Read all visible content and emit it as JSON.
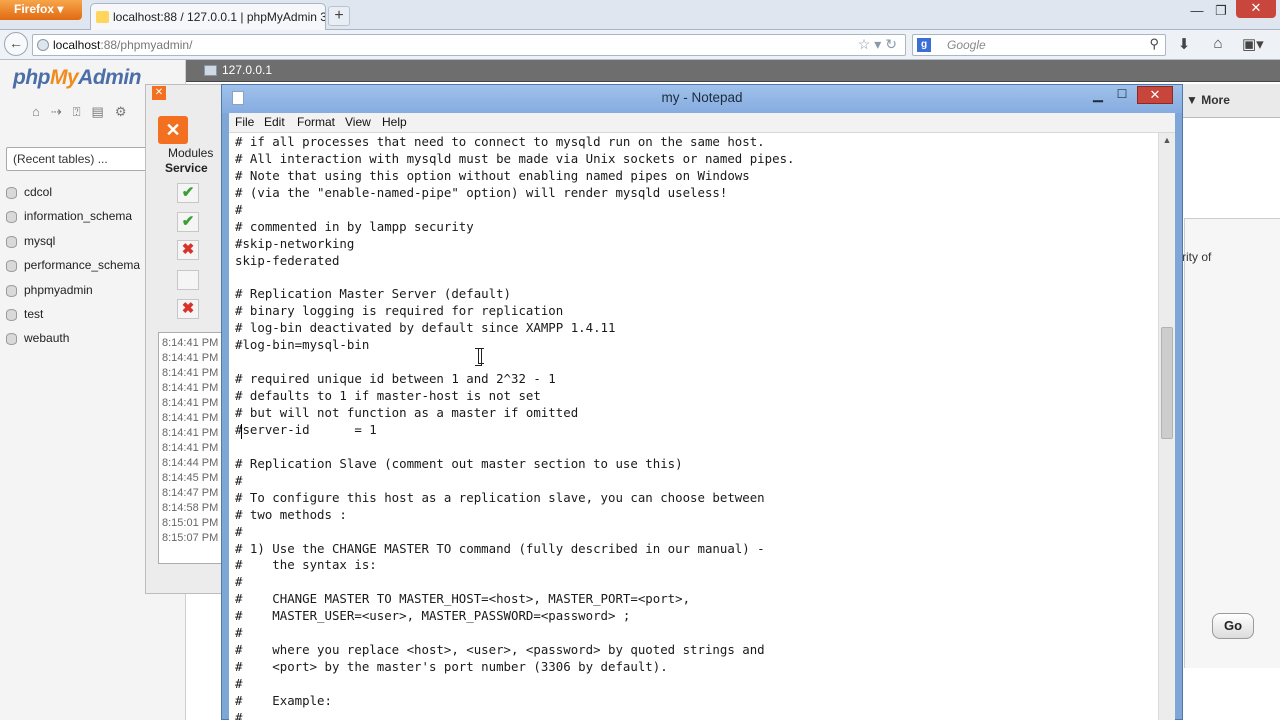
{
  "browser": {
    "app_button": "Firefox",
    "tab_title": "localhost:88 / 127.0.0.1 | phpMyAdmin 3....",
    "new_tab": "+",
    "url_host": "localhost",
    "url_path": ":88/phpmyadmin/",
    "search_engine": "g",
    "search_placeholder": "Google"
  },
  "pma": {
    "logo_php": "php",
    "logo_my": "My",
    "logo_admin": "Admin",
    "recent_tables": "(Recent tables) ...",
    "databases": [
      "cdcol",
      "information_schema",
      "mysql",
      "performance_schema",
      "phpmyadmin",
      "test",
      "webauth"
    ],
    "server_label": "127.0.0.1",
    "more_label": "More",
    "partial_text": "rity of",
    "go_button": "Go"
  },
  "xampp": {
    "modules_label": "Modules",
    "service_label": "Service",
    "service_status": [
      "ok",
      "ok",
      "bad",
      "none",
      "bad"
    ],
    "log_times": [
      "8:14:41 PM",
      "8:14:41 PM",
      "8:14:41 PM",
      "8:14:41 PM",
      "8:14:41 PM",
      "8:14:41 PM",
      "8:14:41 PM",
      "8:14:41 PM",
      "8:14:44 PM",
      "8:14:45 PM",
      "8:14:47 PM",
      "8:14:58 PM",
      "8:15:01 PM",
      "8:15:07 PM"
    ]
  },
  "notepad": {
    "title": "my - Notepad",
    "menu": [
      "File",
      "Edit",
      "Format",
      "View",
      "Help"
    ],
    "lines": [
      "# if all processes that need to connect to mysqld run on the same host.",
      "# All interaction with mysqld must be made via Unix sockets or named pipes.",
      "# Note that using this option without enabling named pipes on Windows",
      "# (via the \"enable-named-pipe\" option) will render mysqld useless!",
      "#",
      "# commented in by lampp security",
      "#skip-networking",
      "skip-federated",
      "",
      "# Replication Master Server (default)",
      "# binary logging is required for replication",
      "# log-bin deactivated by default since XAMPP 1.4.11",
      "#log-bin=mysql-bin",
      "",
      "# required unique id between 1 and 2^32 - 1",
      "# defaults to 1 if master-host is not set",
      "# but will not function as a master if omitted",
      "#server-id      = 1",
      "",
      "# Replication Slave (comment out master section to use this)",
      "#",
      "# To configure this host as a replication slave, you can choose between",
      "# two methods :",
      "#",
      "# 1) Use the CHANGE MASTER TO command (fully described in our manual) -",
      "#    the syntax is:",
      "#",
      "#    CHANGE MASTER TO MASTER_HOST=<host>, MASTER_PORT=<port>,",
      "#    MASTER_USER=<user>, MASTER_PASSWORD=<password> ;",
      "#",
      "#    where you replace <host>, <user>, <password> by quoted strings and",
      "#    <port> by the master's port number (3306 by default).",
      "#",
      "#    Example:",
      "#"
    ]
  }
}
